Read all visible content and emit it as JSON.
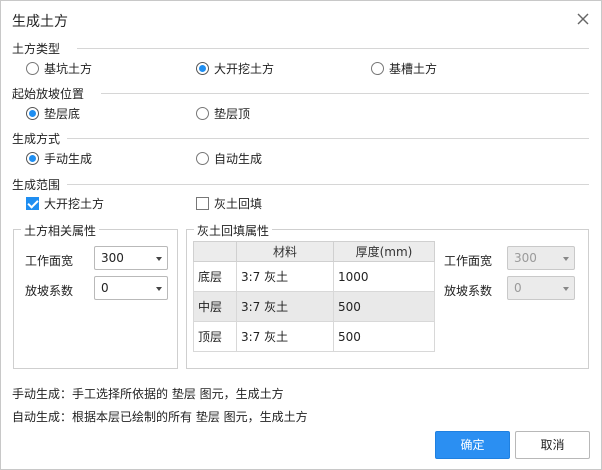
{
  "dialog": {
    "title": "生成土方",
    "close_icon": "close-icon"
  },
  "earthwork_type": {
    "label": "土方类型",
    "options": [
      {
        "label": "基坑土方",
        "selected": false
      },
      {
        "label": "大开挖土方",
        "selected": true
      },
      {
        "label": "基槽土方",
        "selected": false
      }
    ]
  },
  "slope_start": {
    "label": "起始放坡位置",
    "options": [
      {
        "label": "垫层底",
        "selected": true
      },
      {
        "label": "垫层顶",
        "selected": false
      }
    ]
  },
  "gen_mode": {
    "label": "生成方式",
    "options": [
      {
        "label": "手动生成",
        "selected": true
      },
      {
        "label": "自动生成",
        "selected": false
      }
    ]
  },
  "gen_range": {
    "label": "生成范围",
    "options": [
      {
        "label": "大开挖土方",
        "checked": true
      },
      {
        "label": "灰土回填",
        "checked": false
      }
    ]
  },
  "earth_props": {
    "title": "土方相关属性",
    "work_width_label": "工作面宽",
    "work_width_value": "300",
    "slope_coef_label": "放坡系数",
    "slope_coef_value": "0"
  },
  "backfill_props": {
    "title": "灰土回填属性",
    "columns": [
      "",
      "材料",
      "厚度(mm)"
    ],
    "rows": [
      {
        "layer": "底层",
        "material": "3:7 灰土",
        "thickness": "1000"
      },
      {
        "layer": "中层",
        "material": "3:7 灰土",
        "thickness": "500"
      },
      {
        "layer": "顶层",
        "material": "3:7 灰土",
        "thickness": "500"
      }
    ],
    "work_width_label": "工作面宽",
    "work_width_value": "300",
    "slope_coef_label": "放坡系数",
    "slope_coef_value": "0"
  },
  "notes": {
    "manual": "手动生成：手工选择所依据的 垫层 图元，生成土方",
    "auto": "自动生成：根据本层已绘制的所有 垫层 图元，生成土方"
  },
  "buttons": {
    "ok": "确定",
    "cancel": "取消"
  },
  "colors": {
    "accent": "#1f8ef1",
    "primary_button": "#2b8ff2",
    "row_highlight": "#e9e9e9"
  }
}
